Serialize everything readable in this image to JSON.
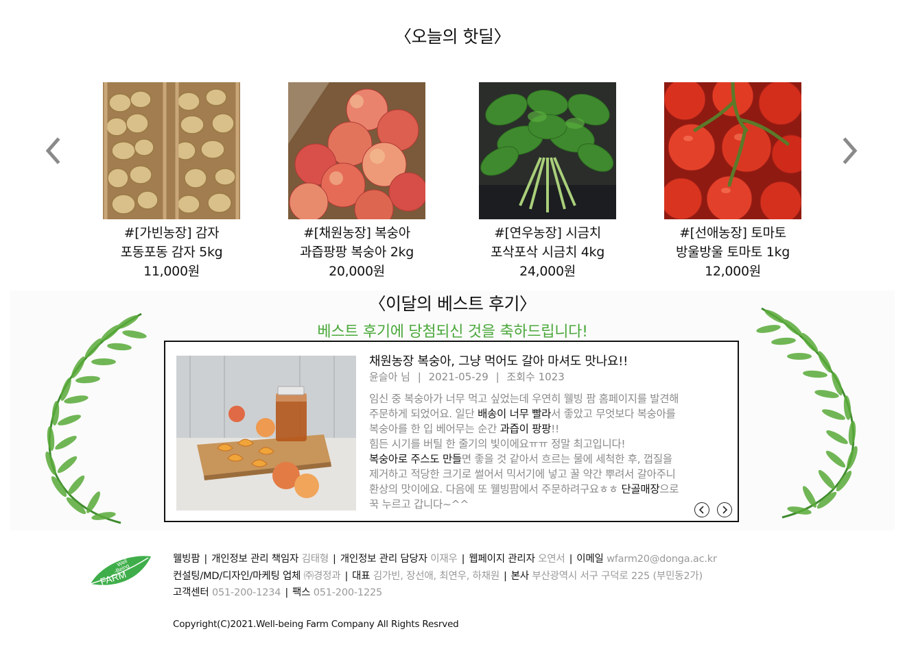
{
  "hot_deal": {
    "title": "〈오늘의 핫딜〉",
    "products": [
      {
        "line1": "#[가빈농장] 감자",
        "line2": "포동포동 감자 5kg",
        "price": "11,000원"
      },
      {
        "line1": "#[채원농장] 복숭아",
        "line2": "과즙팡팡 복숭아 2kg",
        "price": "20,000원"
      },
      {
        "line1": "#[연우농장] 시금치",
        "line2": "포삭포삭 시금치  4kg",
        "price": "24,000원"
      },
      {
        "line1": "#[선애농장] 토마토",
        "line2": "방울방울 토마토 1kg",
        "price": "12,000원"
      }
    ]
  },
  "best_review": {
    "title": "〈이달의 베스트 후기〉",
    "congrats": "베스트 후기에 당첨되신 것을 축하드립니다!",
    "headline": "채원농장 복숭아, 그냥 먹어도 갈아 마셔도 맛나요!!",
    "author": "윤슬아 님",
    "sep1": "|",
    "date": "2021-05-29",
    "sep2": "|",
    "views": "조회수 1023",
    "body": {
      "l1": "임신 중 복숭아가 너무 먹고 싶었는데 우연히 웰빙 팜 홈페이지를 발견해",
      "l2a": "주문하게 되었어요. 일단 ",
      "l2b": "배송이 너무 빨라",
      "l2c": "서 좋았고 무엇보다 복숭아를",
      "l3a": "복숭아를 한 입 베어무는 순간 ",
      "l3b": "과즙이 팡팡",
      "l3c": "!!",
      "l4": "힘든 시기를 버틸 한 줄기의 빛이에요ㅠㅠ 정말 최고입니다!",
      "l5a": "복숭아로 주스도 만들",
      "l5b": "면 좋을 것 같아서 흐르는 물에 세척한 후, 껍질을",
      "l6": "제거하고 적당한 크기로 썰어서 믹서기에 넣고 꿀 약간 뿌려서 갈아주니",
      "l7a": "환상의 맛이에요. 다음에 또 웰빙팜에서 주문하려구요ㅎㅎ ",
      "l7b": "단골매장",
      "l7c": "으로",
      "l8": "꾹 누르고 갑니다~^^"
    }
  },
  "footer": {
    "logo_top": "Well",
    "logo_mid": "-Being",
    "logo_bottom": "FARM",
    "sep": "|",
    "row1": {
      "k1": "웰빙팜",
      "k2": "개인정보 관리 책임자",
      "v2": "김태형",
      "k3": "개인정보 관리 담당자",
      "v3": "이재우",
      "k4": "웹페이지 관리자",
      "v4": "오연서",
      "k5": "이메일",
      "v5": "wfarm20@donga.ac.kr"
    },
    "row2": {
      "k1": "컨설팅/MD/디자인/마케팅 업체",
      "v1": "㈜경정과",
      "k2": "대표",
      "v2": "김가빈, 장선애, 최연우, 하채원",
      "k3": "본사",
      "v3": "부산광역시 서구 구덕로 225 (부민동2가)"
    },
    "row3": {
      "k1": "고객센터",
      "v1": "051-200-1234",
      "k2": "팩스",
      "v2": "051-200-1225"
    },
    "copyright": "Copyright(C)2021.Well-being Farm Company All Rights Resrved"
  },
  "icons": {
    "prev": "chevron-left-icon",
    "next": "chevron-right-icon",
    "review_prev": "circle-chevron-left-icon",
    "review_next": "circle-chevron-right-icon"
  },
  "colors": {
    "accent_green": "#4aa83a",
    "muted_text": "#8a8a8a"
  }
}
